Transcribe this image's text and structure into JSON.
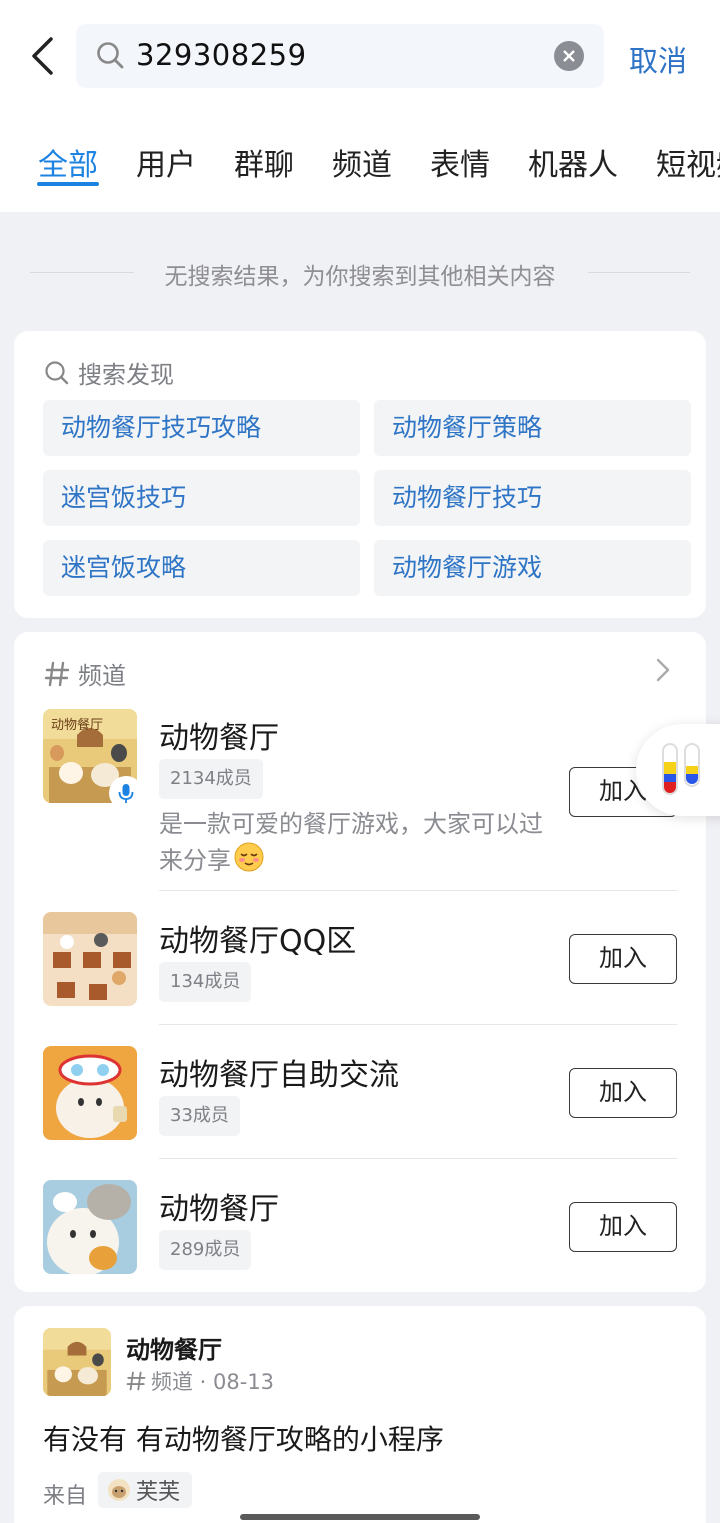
{
  "search": {
    "query": "329308259",
    "cancel_label": "取消"
  },
  "tabs": [
    {
      "label": "全部",
      "active": true
    },
    {
      "label": "用户"
    },
    {
      "label": "群聊"
    },
    {
      "label": "频道"
    },
    {
      "label": "表情"
    },
    {
      "label": "机器人"
    },
    {
      "label": "短视频"
    }
  ],
  "no_result_text": "无搜索结果，为你搜索到其他相关内容",
  "discover": {
    "title": "搜索发现",
    "chips": [
      "动物餐厅技巧攻略",
      "动物餐厅策略",
      "迷宫饭技巧",
      "动物餐厅技巧",
      "迷宫饭攻略",
      "动物餐厅游戏"
    ]
  },
  "channels": {
    "title": "频道",
    "join_label": "加入",
    "items": [
      {
        "name": "动物餐厅",
        "members": "2134成员",
        "desc": "是一款可爱的餐厅游戏，大家可以过来分享"
      },
      {
        "name": "动物餐厅QQ区",
        "members": "134成员"
      },
      {
        "name": "动物餐厅自助交流",
        "members": "33成员"
      },
      {
        "name": "动物餐厅",
        "members": "289成员"
      }
    ]
  },
  "post": {
    "author": "动物餐厅",
    "meta": "频道 · 08-13",
    "title": "有没有 有动物餐厅攻略的小程序",
    "from_label": "来自",
    "from_user": "芙芙"
  },
  "colors": {
    "accent": "#1d83e3",
    "link": "#2f75c6",
    "cancel": "#2e73c6"
  }
}
